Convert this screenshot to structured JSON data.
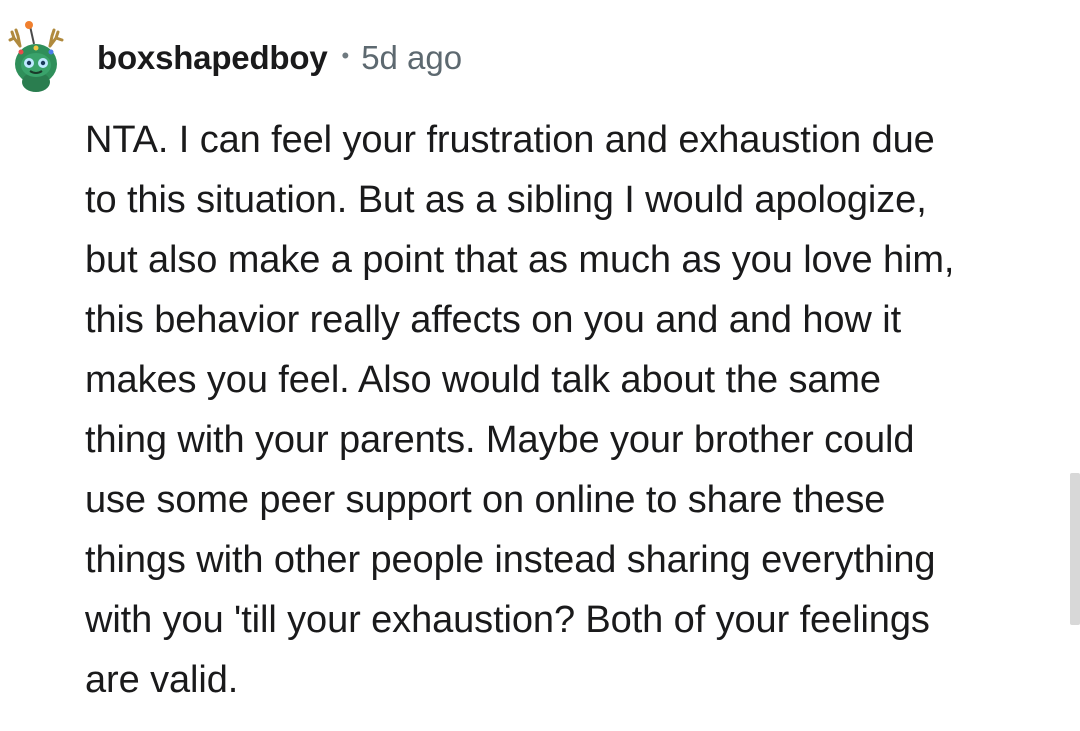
{
  "comment": {
    "author": "boxshapedboy",
    "separator": "•",
    "timestamp": "5d ago",
    "avatar_icon": "snoo-avatar-icon",
    "body_lines": [
      "NTA. I can feel your frustration and exhaustion due",
      "to this situation. But as a sibling I would apologize,",
      "but also make a point that as much as you love him,",
      "this behavior really affects on you and and how it",
      "makes you feel. Also would talk about the same",
      "thing with your parents. Maybe your brother could",
      "use some peer support on online to share these",
      "things with other people instead sharing everything",
      "with you 'till your exhaustion? Both of your feelings",
      "are valid."
    ]
  },
  "colors": {
    "text": "#1a1a1b",
    "meta": "#5d6970",
    "avatar_green": "#2f8f5a",
    "scrollbar": "#d8d8d8"
  }
}
